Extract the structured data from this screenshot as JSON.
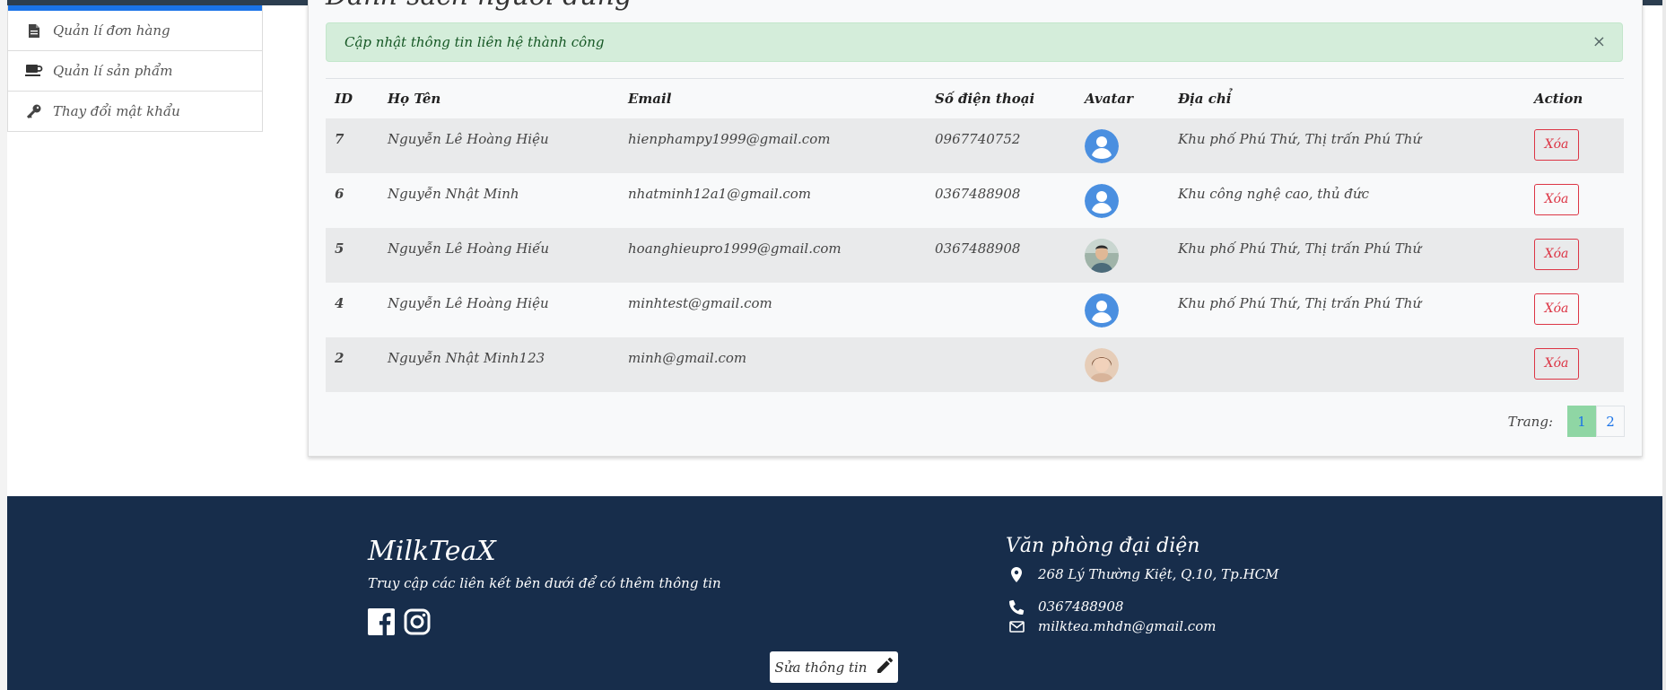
{
  "sidebar": {
    "items": [
      {
        "label": "Quản lí đơn hàng",
        "icon": "file-icon"
      },
      {
        "label": "Quản lí sản phẩm",
        "icon": "coffee-cup-icon"
      },
      {
        "label": "Thay đổi mật khẩu",
        "icon": "key-icon"
      }
    ]
  },
  "main": {
    "title": "Danh sách người dùng",
    "alert": {
      "text": "Cập nhật thông tin liên hệ thành công",
      "close": "×"
    },
    "table": {
      "headers": [
        "ID",
        "Họ Tên",
        "Email",
        "Số điện thoại",
        "Avatar",
        "Địa chỉ",
        "Action"
      ],
      "rows": [
        {
          "id": "7",
          "name": "Nguyễn Lê Hoàng Hiệu",
          "email": "hienphampy1999@gmail.com",
          "phone": "0967740752",
          "avatar": "default-user-icon",
          "address": "Khu phố Phú Thứ, Thị trấn Phú Thứ",
          "action": "Xóa"
        },
        {
          "id": "6",
          "name": "Nguyễn Nhật Minh",
          "email": "nhatminh12a1@gmail.com",
          "phone": "0367488908",
          "avatar": "default-user-icon",
          "address": "Khu công nghệ cao, thủ đức",
          "action": "Xóa"
        },
        {
          "id": "5",
          "name": "Nguyễn Lê Hoàng Hiếu",
          "email": "hoanghieupro1999@gmail.com",
          "phone": "0367488908",
          "avatar": "photo-man",
          "address": "Khu phố Phú Thứ, Thị trấn Phú Thứ",
          "action": "Xóa"
        },
        {
          "id": "4",
          "name": "Nguyễn Lê Hoàng Hiệu",
          "email": "minhtest@gmail.com",
          "phone": "",
          "avatar": "default-user-icon",
          "address": "Khu phố Phú Thứ, Thị trấn Phú Thứ",
          "action": "Xóa"
        },
        {
          "id": "2",
          "name": "Nguyễn Nhật Minh123",
          "email": "minh@gmail.com",
          "phone": "",
          "avatar": "photo-woman",
          "address": "",
          "action": "Xóa"
        }
      ]
    },
    "pagination": {
      "label": "Trang:",
      "pages": [
        "1",
        "2"
      ],
      "current": "1"
    }
  },
  "footer": {
    "brand": "MilkTeaX",
    "subtitle": "Truy cập các liên kết bên dưới để có thêm thông tin",
    "social": [
      "facebook-icon",
      "instagram-icon"
    ],
    "office": {
      "title": "Văn phòng đại diện",
      "address": "268 Lý Thường Kiệt, Q.10, Tp.HCM",
      "phone": "0367488908",
      "email": "milktea.mhdn@gmail.com"
    },
    "edit_button": "Sửa thông tin"
  },
  "colors": {
    "accent": "#1a73e8",
    "footer_bg": "#172d4b",
    "alert_bg": "#d4edda",
    "alert_text": "#155724",
    "danger": "#dc3545",
    "page_active": "#8fd6a4"
  }
}
